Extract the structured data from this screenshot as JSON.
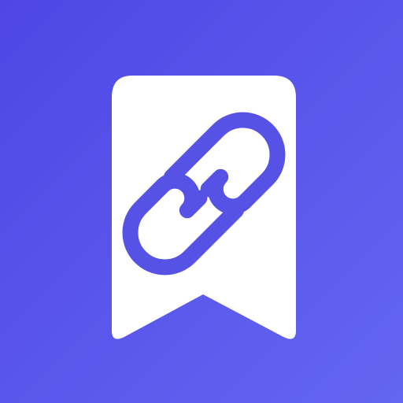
{
  "icon": {
    "name": "bookmark-link-icon",
    "glyph": "bookmark-icon",
    "emblem": "link-icon"
  },
  "colors": {
    "background_start": "#4f46e5",
    "background_end": "#6366f1",
    "bookmark_fill": "#ffffff",
    "link_stroke": "#5652e6"
  }
}
